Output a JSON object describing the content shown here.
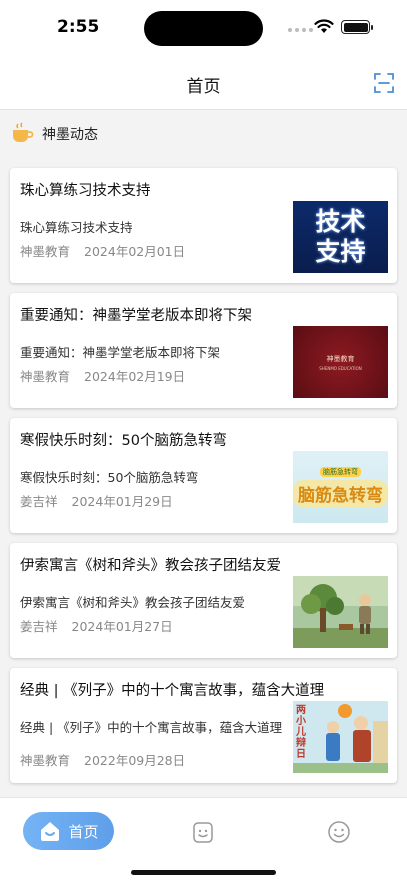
{
  "status_bar": {
    "time": "2:55"
  },
  "nav": {
    "title": "首页",
    "scan_icon": "scan-icon"
  },
  "section": {
    "title": "神墨动态",
    "icon": "coffee-cup-icon"
  },
  "articles": [
    {
      "title": "珠心算练习技术支持",
      "summary": "珠心算练习技术支持",
      "author": "神墨教育",
      "date": "2024年02月01日",
      "thumb_text": [
        "技术",
        "支持"
      ]
    },
    {
      "title": "重要通知：神墨学堂老版本即将下架",
      "summary": "重要通知：神墨学堂老版本即将下架",
      "author": "神墨教育",
      "date": "2024年02月19日",
      "thumb_text": [
        "神墨教育",
        "SHENMO EDUCATION"
      ]
    },
    {
      "title": "寒假快乐时刻：50个脑筋急转弯",
      "summary": "寒假快乐时刻：50个脑筋急转弯",
      "author": "姜吉祥",
      "date": "2024年01月29日",
      "thumb_text": [
        "脑筋急转弯",
        "脑筋急转弯"
      ]
    },
    {
      "title": "伊索寓言《树和斧头》教会孩子团结友爱",
      "summary": "伊索寓言《树和斧头》教会孩子团结友爱",
      "author": "姜吉祥",
      "date": "2024年01月27日",
      "thumb_text": []
    },
    {
      "title": "经典 | 《列子》中的十个寓言故事，蕴含大道理",
      "summary": "经典 | 《列子》中的十个寓言故事，蕴含大道理",
      "author": "神墨教育",
      "date": "2022年09月28日",
      "thumb_text": [
        "两小儿辩日"
      ]
    }
  ],
  "tabbar": {
    "home_label": "首页",
    "tabs": [
      "home-icon",
      "robot-face-icon",
      "smiley-face-icon"
    ]
  },
  "colors": {
    "accent": "#6aa9ef",
    "background": "#f3f3f3",
    "meta_text": "#888888"
  }
}
